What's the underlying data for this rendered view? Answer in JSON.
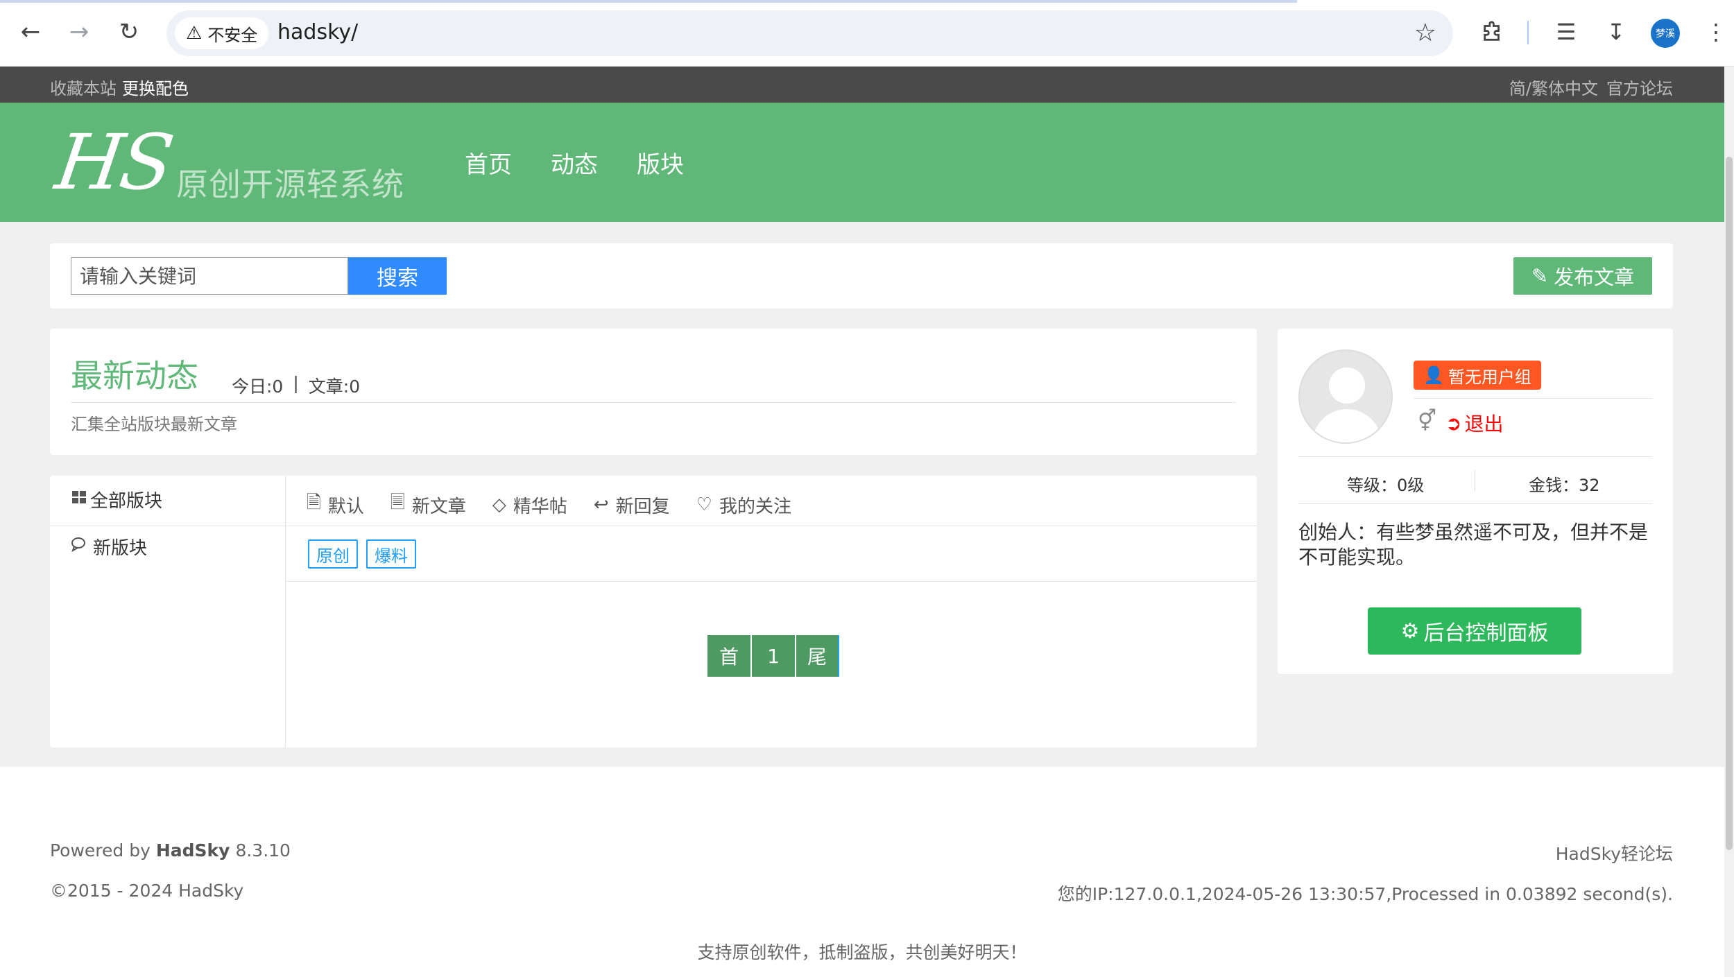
{
  "browser": {
    "security_label": "不安全",
    "url": "hadsky/",
    "profile_initials": "梦溪"
  },
  "topbar": {
    "bookmark": "收藏本站",
    "change_color": "更换配色",
    "language": "简/繁体中文",
    "official_forum": "官方论坛"
  },
  "header": {
    "logo": "HS",
    "logo_sub": "原创开源轻系统",
    "nav": [
      "首页",
      "动态",
      "版块"
    ]
  },
  "search": {
    "placeholder": "请输入关键词",
    "button": "搜索",
    "post_button": "发布文章"
  },
  "latest": {
    "title": "最新动态",
    "today": "今日:0",
    "separator": "|",
    "articles": "文章:0",
    "description": "汇集全站版块最新文章"
  },
  "forum": {
    "sidebar": [
      "全部版块",
      "新版块"
    ],
    "tabs": [
      "默认",
      "新文章",
      "精华帖",
      "新回复",
      "我的关注"
    ],
    "tags": [
      "原创",
      "爆料"
    ],
    "pager": [
      "首",
      "1",
      "尾"
    ]
  },
  "user": {
    "group": "暂无用户组",
    "logout": "退出",
    "level": "等级：0级",
    "money": "金钱：32",
    "founder_text": "创始人：有些梦虽然遥不可及，但并不是不可能实现。",
    "admin_button": "后台控制面板"
  },
  "footer": {
    "powered_prefix": "Powered by",
    "powered_name": "HadSky",
    "powered_version": "8.3.10",
    "copyright": "©2015 - 2024 HadSky",
    "brand": "HadSky轻论坛",
    "ip_info": "您的IP:127.0.0.1,2024-05-26 13:30:57,Processed in 0.03892 second(s).",
    "slogan": "支持原创软件，抵制盗版，共创美好明天！"
  },
  "colors": {
    "accent_green": "#5fb878",
    "search_blue": "#2f8bff",
    "badge_orange": "#ff5722",
    "logout_red": "#ff0000",
    "admin_green": "#2eb85c"
  }
}
